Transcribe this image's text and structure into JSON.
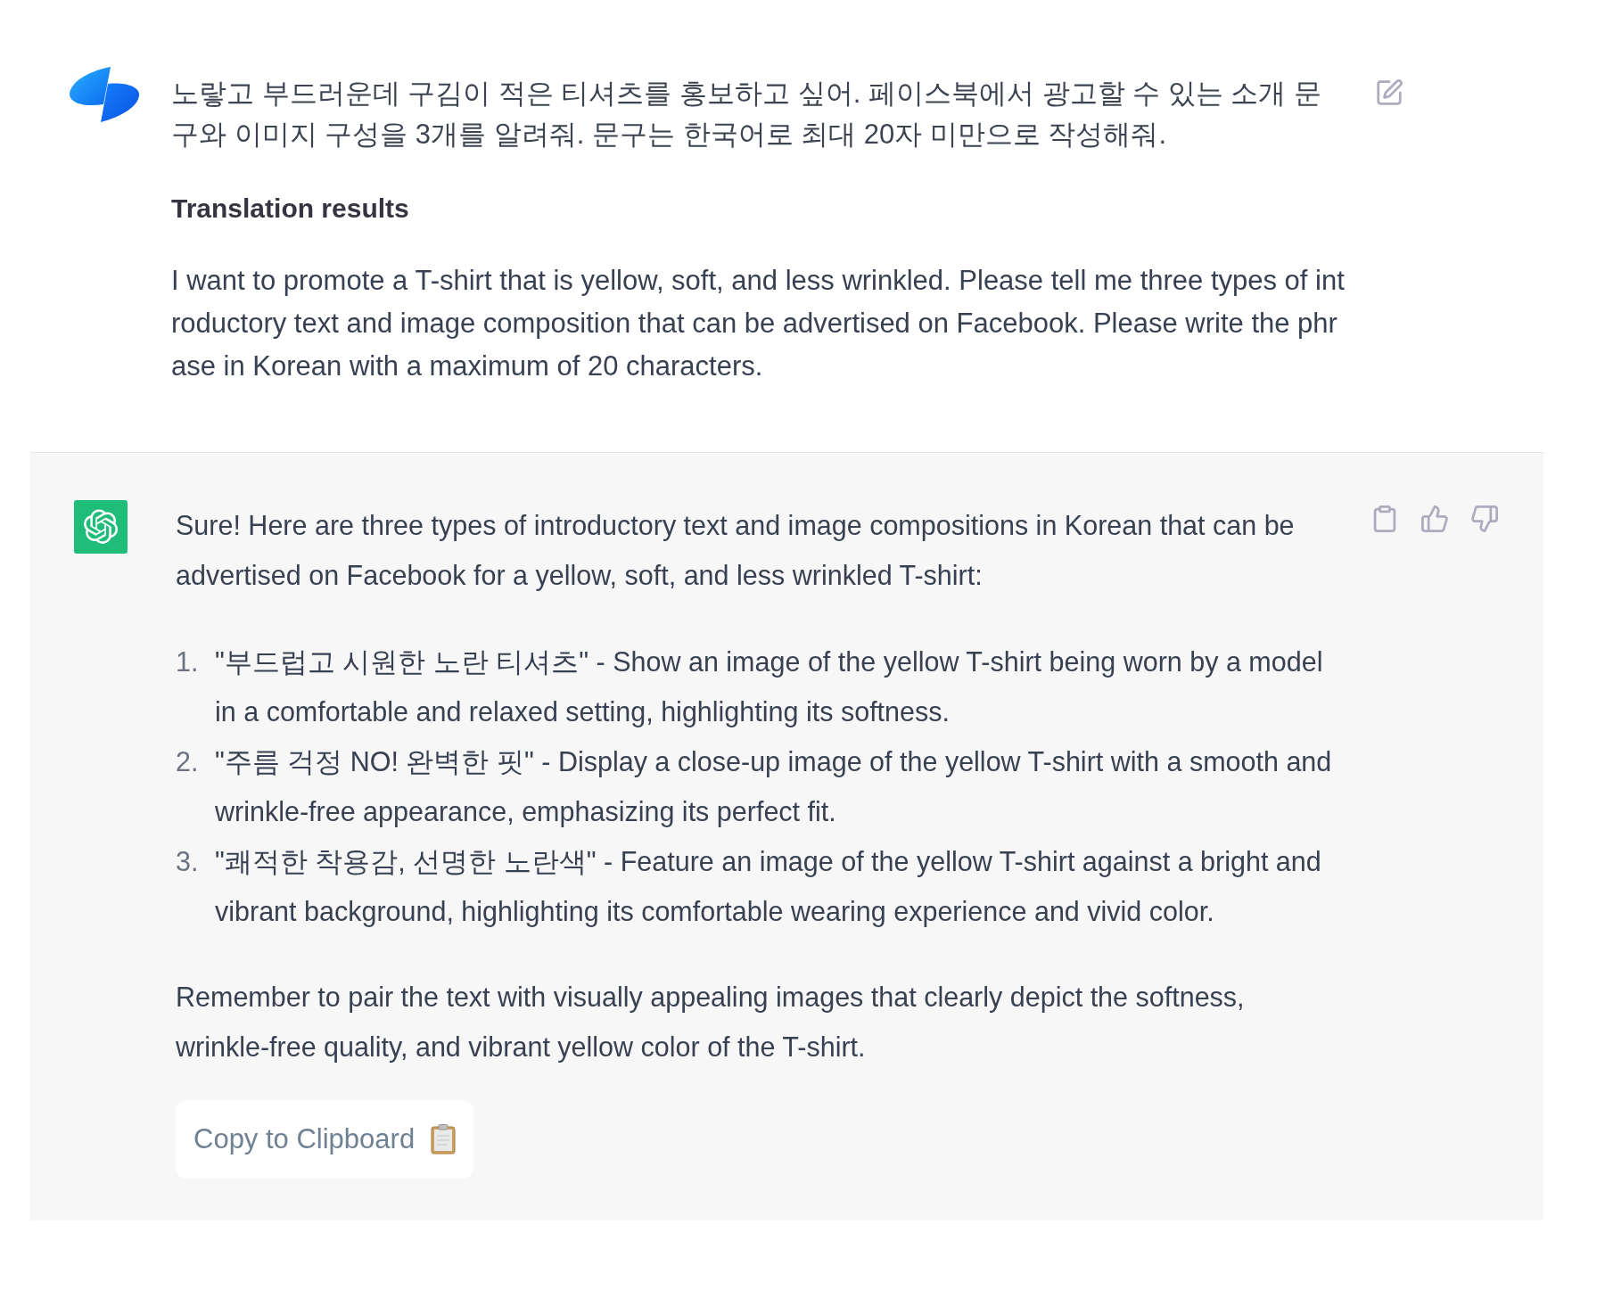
{
  "messages": [
    {
      "kind": "user",
      "text": "노랗고 부드러운데 구김이 적은 티셔츠를 홍보하고 싶어. 페이스북에서 광고할 수 있는 소개 문구와 이미지 구성을 3개를 알려줘. 문구는 한국어로 최대 20자 미만으로 작성해줘.",
      "translation": {
        "heading": "Translation results",
        "text": "I want to promote a T-shirt that is yellow, soft, and less wrinkled. Please tell me three types of introductory text and image composition that can be advertised on Facebook. Please write the phrase in Korean with a maximum of 20 characters."
      }
    },
    {
      "kind": "assistant",
      "intro": "Sure! Here are three types of introductory text and image compositions in Korean that can be advertised on Facebook for a yellow, soft, and less wrinkled T-shirt:",
      "items": [
        {
          "number": "1.",
          "text": "\"부드럽고 시원한 노란 티셔츠\" - Show an image of the yellow T-shirt being worn by a model in a comfortable and relaxed setting, highlighting its softness."
        },
        {
          "number": "2.",
          "text": "\"주름 걱정 NO! 완벽한 핏\" - Display a close-up image of the yellow T-shirt with a smooth and wrinkle-free appearance, emphasizing its perfect fit."
        },
        {
          "number": "3.",
          "text": "\"쾌적한 착용감, 선명한 노란색\" - Feature an image of the yellow T-shirt against a bright and vibrant background, highlighting its comfortable wearing experience and vivid color."
        }
      ],
      "closing": "Remember to pair the text with visually appealing images that clearly depict the softness, wrinkle-free quality, and vibrant yellow color of the T-shirt.",
      "copy_button": {
        "label": "Copy to Clipboard"
      }
    }
  ]
}
